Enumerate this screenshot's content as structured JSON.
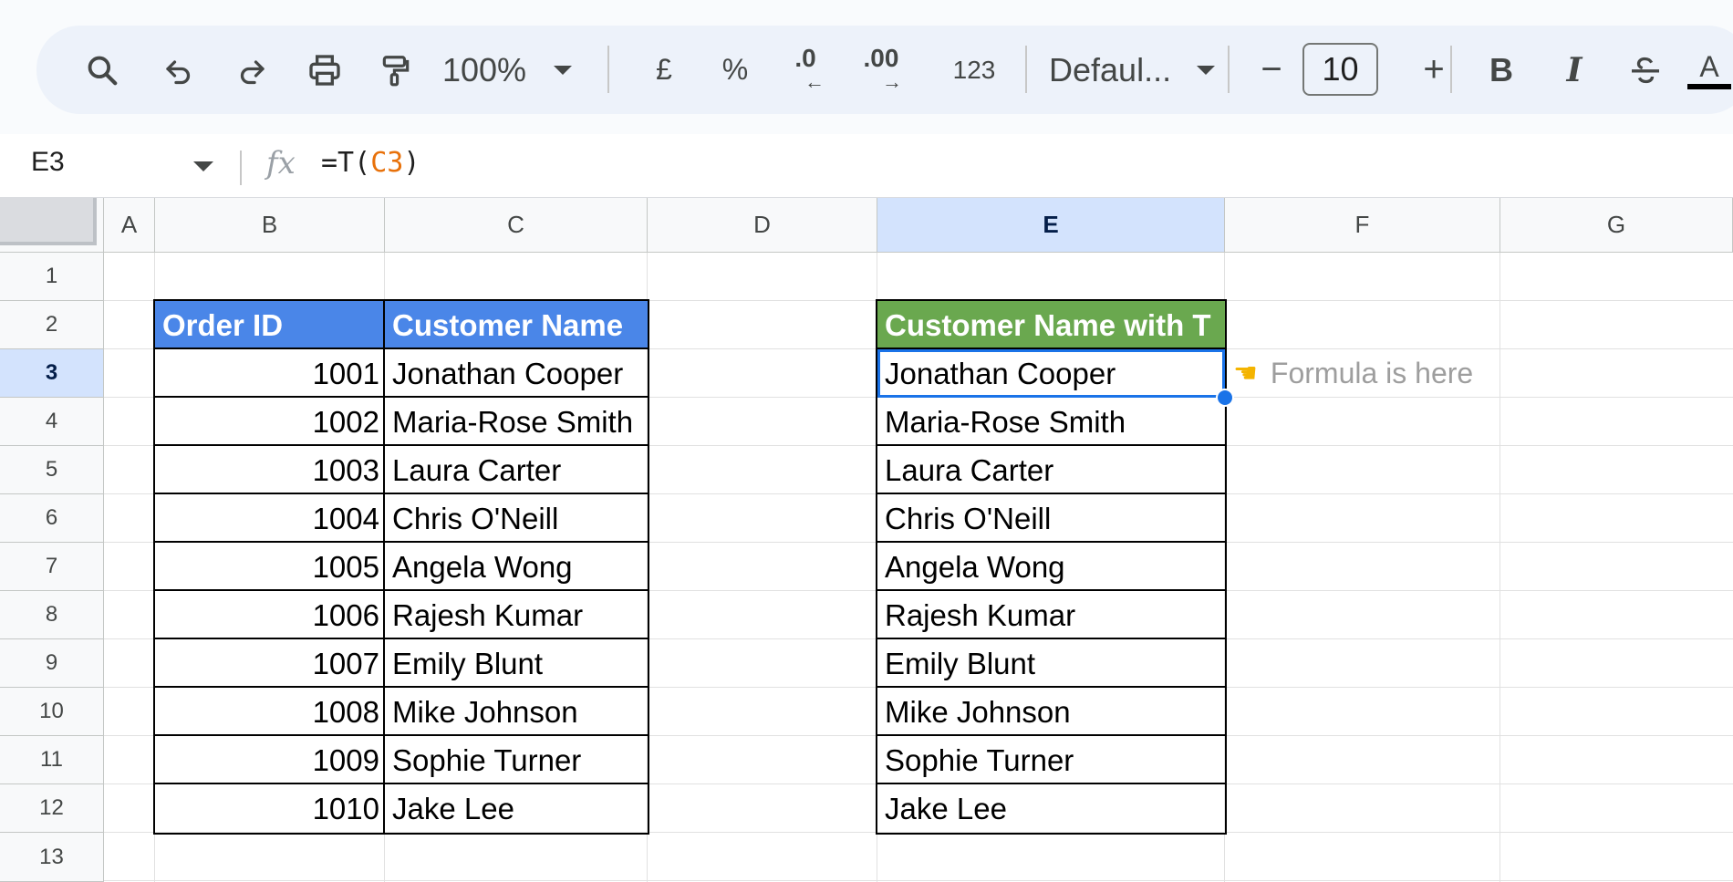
{
  "toolbar": {
    "zoom": "100%",
    "currency": "£",
    "percent": "%",
    "decrease_decimals": ".0",
    "increase_decimals": ".00",
    "number_format": "123",
    "font": "Defaul...",
    "font_size": "10",
    "minus": "−",
    "plus": "+",
    "bold": "B",
    "italic": "I",
    "text_color": "A"
  },
  "formula_bar": {
    "cell_ref": "E3",
    "fx": "fx",
    "formula_prefix": "=T(",
    "formula_ref": "C3",
    "formula_suffix": ")"
  },
  "columns": [
    "A",
    "B",
    "C",
    "D",
    "E",
    "F",
    "G"
  ],
  "rows": [
    "1",
    "2",
    "3",
    "4",
    "5",
    "6",
    "7",
    "8",
    "9",
    "10",
    "11",
    "12",
    "13"
  ],
  "selected_cell": "E3",
  "table": {
    "header_order_id": "Order ID",
    "header_customer": "Customer Name",
    "header_customer_t": "Customer Name with T",
    "rows": [
      {
        "id": "1001",
        "name": "Jonathan Cooper",
        "t": "Jonathan Cooper"
      },
      {
        "id": "1002",
        "name": "Maria-Rose Smith",
        "t": "Maria-Rose Smith"
      },
      {
        "id": "1003",
        "name": "Laura Carter",
        "t": "Laura Carter"
      },
      {
        "id": "1004",
        "name": "Chris O'Neill",
        "t": "Chris O'Neill"
      },
      {
        "id": "1005",
        "name": "Angela Wong",
        "t": "Angela Wong"
      },
      {
        "id": "1006",
        "name": "Rajesh Kumar",
        "t": "Rajesh Kumar"
      },
      {
        "id": "1007",
        "name": "Emily Blunt",
        "t": "Emily Blunt"
      },
      {
        "id": "1008",
        "name": "Mike Johnson",
        "t": "Mike Johnson"
      },
      {
        "id": "1009",
        "name": "Sophie Turner",
        "t": "Sophie Turner"
      },
      {
        "id": "1010",
        "name": "Jake Lee",
        "t": "Jake Lee"
      }
    ]
  },
  "note": {
    "hand_icon": "pointing-hand-icon",
    "text": "Formula is here"
  },
  "colors": {
    "header_blue": "#4a86e8",
    "header_green": "#6aa84f",
    "selection": "#1a73e8"
  }
}
